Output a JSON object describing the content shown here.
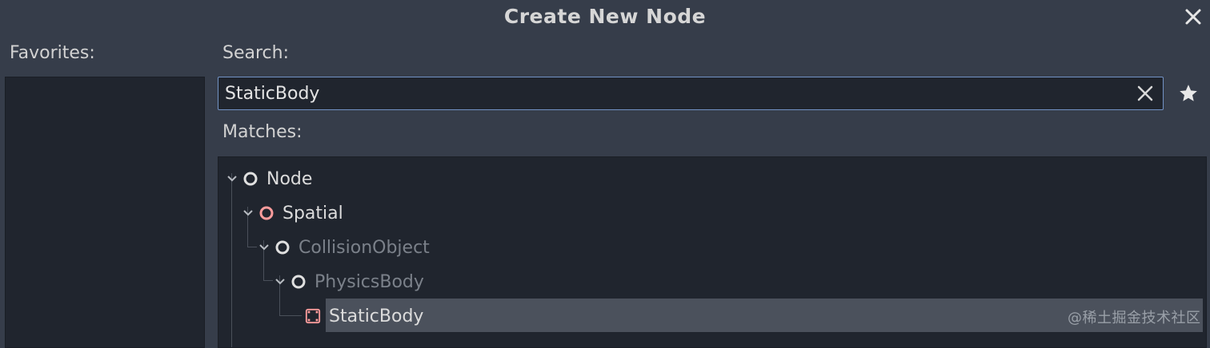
{
  "dialog": {
    "title": "Create New Node"
  },
  "favorites": {
    "label": "Favorites:"
  },
  "search": {
    "label": "Search:",
    "value": "StaticBody"
  },
  "matches": {
    "label": "Matches:",
    "tree": [
      {
        "label": "Node",
        "icon": "node-circle-icon",
        "depth": 0,
        "expanded": true,
        "dimmed": false
      },
      {
        "label": "Spatial",
        "icon": "spatial-circle-icon",
        "depth": 1,
        "expanded": true,
        "dimmed": false
      },
      {
        "label": "CollisionObject",
        "icon": "node-circle-icon",
        "depth": 2,
        "expanded": true,
        "dimmed": true
      },
      {
        "label": "PhysicsBody",
        "icon": "node-circle-icon",
        "depth": 3,
        "expanded": true,
        "dimmed": true
      },
      {
        "label": "StaticBody",
        "icon": "static-body-icon",
        "depth": 4,
        "expanded": false,
        "dimmed": false,
        "selected": true
      }
    ]
  },
  "watermark": {
    "text": "@稀土掘金技术社区"
  },
  "colors": {
    "background": "#363d4a",
    "panel": "#20252e",
    "accent_border": "#7293c5",
    "spatial_icon": "#fc9c9c",
    "node_icon": "#e0e0e0",
    "selected_row": "#4b515c"
  }
}
